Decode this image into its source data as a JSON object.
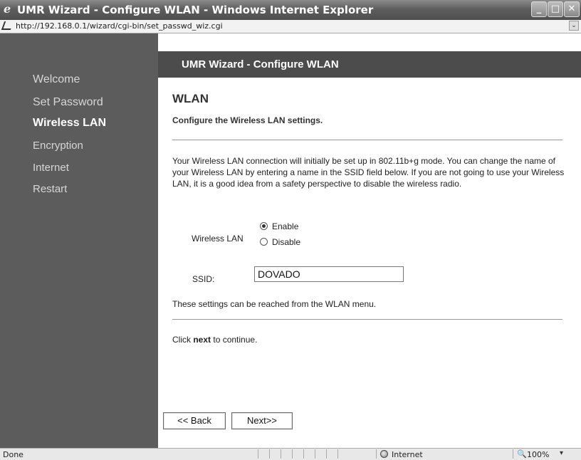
{
  "window": {
    "title": "UMR Wizard - Configure WLAN - Windows Internet Explorer",
    "minimize": "_",
    "maximize": "□",
    "close": "✕"
  },
  "address_bar": {
    "url": "http://192.168.0.1/wizard/cgi-bin/set_passwd_wiz.cgi",
    "dropdown": "⌄"
  },
  "sidebar": {
    "items": [
      {
        "label": "Welcome",
        "active": false
      },
      {
        "label": "Set Password",
        "active": false
      },
      {
        "label": "Wireless LAN",
        "active": true
      },
      {
        "label": "Encryption",
        "active": false
      },
      {
        "label": "Internet",
        "active": false
      },
      {
        "label": "Restart",
        "active": false
      }
    ]
  },
  "main": {
    "header": "UMR Wizard - Configure WLAN",
    "heading": "WLAN",
    "subheading": "Configure the Wireless LAN settings.",
    "description": "Your Wireless LAN connection will initially be set up in 802.11b+g mode. You can change the name of your Wireless LAN by entering a name in the SSID field below. If you are not going to use your Wireless LAN, it is a good idea from a safety perspective to disable the wireless radio.",
    "wireless_lan_label": "Wireless LAN",
    "radio_enable": "Enable",
    "radio_disable": "Disable",
    "radio_selected": "Enable",
    "ssid_label": "SSID:",
    "ssid_value": "DOVADO",
    "reach_text": "These settings can be reached from the WLAN menu.",
    "click_prefix": "Click ",
    "click_bold": "next",
    "click_suffix": " to continue.",
    "back_button": "<< Back",
    "next_button": "Next>>"
  },
  "status_bar": {
    "status": "Done",
    "zone": "Internet",
    "zoom_icon": "🔍",
    "zoom": "100%",
    "zoom_dropdown": "▾"
  }
}
